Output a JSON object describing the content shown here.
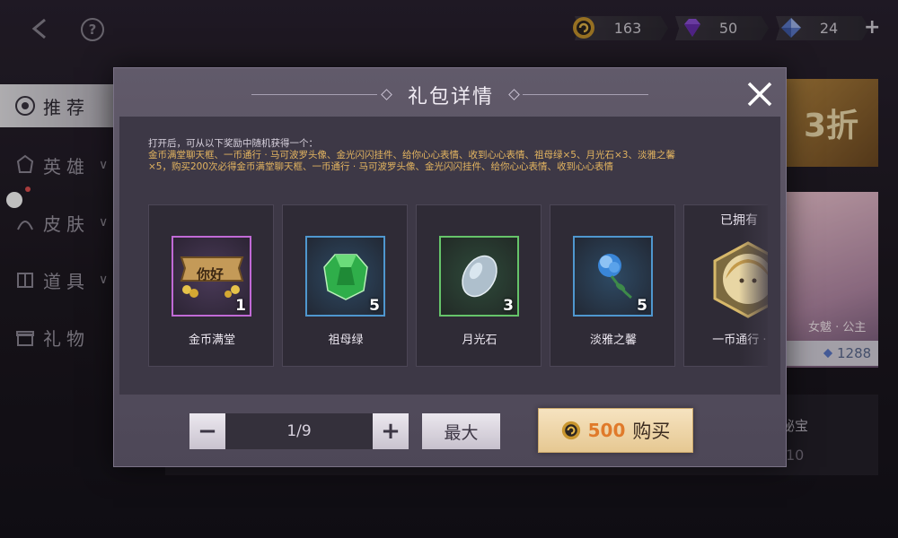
{
  "topbar": {
    "help_label": "?",
    "currencies": [
      {
        "icon": "gold-coin-icon",
        "value": "163"
      },
      {
        "icon": "purple-diamond-icon",
        "value": "50"
      },
      {
        "icon": "blue-diamond-icon",
        "value": "24"
      }
    ],
    "add_label": "+"
  },
  "sidebar": {
    "items": [
      {
        "label": "推荐",
        "icon": "recommend-icon"
      },
      {
        "label": "英雄",
        "icon": "hero-icon"
      },
      {
        "label": "皮肤",
        "icon": "skin-icon"
      },
      {
        "label": "道具",
        "icon": "item-icon"
      },
      {
        "label": "礼物",
        "icon": "gift-icon"
      }
    ]
  },
  "background": {
    "banner_text": "3折",
    "card_name": "女魃 · 公主",
    "card_price": "1288",
    "row_text": "能秘宝",
    "row_num": "10"
  },
  "modal": {
    "title": "礼包详情",
    "close_icon": "close-icon",
    "description_intro": "打开后，可从以下奖励中随机获得一个：",
    "description_body": "金币满堂聊天框、一币通行 · 马可波罗头像、金光闪闪挂件、给你心心表情、收到心心表情、祖母绿×5、月光石×3、淡雅之馨×5，购买200次必得金币满堂聊天框、一币通行 · 马可波罗头像、金光闪闪挂件、给你心心表情、收到心心表情",
    "items": [
      {
        "name": "金币满堂",
        "count": "1",
        "badge": "你好",
        "rarity": "purple"
      },
      {
        "name": "祖母绿",
        "count": "5",
        "rarity": "blue"
      },
      {
        "name": "月光石",
        "count": "3",
        "rarity": "green"
      },
      {
        "name": "淡雅之馨",
        "count": "5",
        "rarity": "blue"
      },
      {
        "name": "一币通行 · 马",
        "count": "",
        "owned": "已拥有",
        "rarity": "gold"
      }
    ],
    "quantity": {
      "minus": "−",
      "value": "1/9",
      "plus": "+"
    },
    "max_label": "最大",
    "buy": {
      "price": "500",
      "label": "购买"
    }
  }
}
